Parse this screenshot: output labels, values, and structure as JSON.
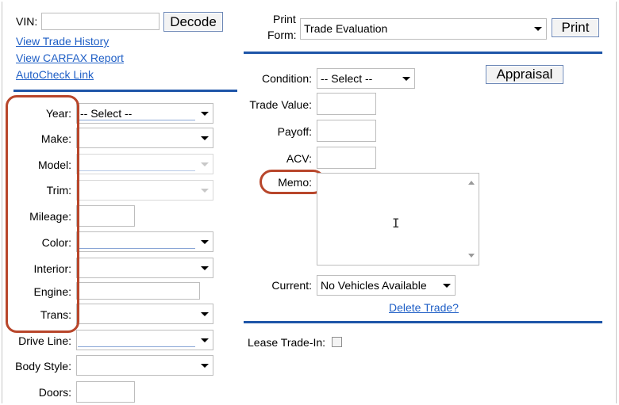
{
  "left": {
    "vin_label": "VIN:",
    "vin_value": "",
    "decode_label": "Decode",
    "links": [
      "View Trade History",
      "View CARFAX Report",
      "AutoCheck Link"
    ],
    "fields": {
      "year": {
        "label": "Year:",
        "value": "-- Select --"
      },
      "make": {
        "label": "Make:",
        "value": ""
      },
      "model": {
        "label": "Model:",
        "value": ""
      },
      "trim": {
        "label": "Trim:",
        "value": ""
      },
      "mileage": {
        "label": "Mileage:",
        "value": ""
      },
      "color": {
        "label": "Color:",
        "value": ""
      },
      "interior": {
        "label": "Interior:",
        "value": ""
      },
      "engine": {
        "label": "Engine:",
        "value": ""
      },
      "trans": {
        "label": "Trans:",
        "value": ""
      },
      "drive_line": {
        "label": "Drive Line:",
        "value": ""
      },
      "body_style": {
        "label": "Body Style:",
        "value": ""
      },
      "doors": {
        "label": "Doors:",
        "value": ""
      }
    }
  },
  "right": {
    "print_form_label_1": "Print",
    "print_form_label_2": "Form:",
    "print_form_value": "Trade Evaluation",
    "print_label": "Print",
    "appraisal_label": "Appraisal",
    "condition": {
      "label": "Condition:",
      "value": "-- Select --"
    },
    "trade_value_label": "Trade Value:",
    "payoff_label": "Payoff:",
    "acv_label": "ACV:",
    "memo_label": "Memo:",
    "memo_value": "",
    "current": {
      "label": "Current:",
      "value": "No Vehicles Available"
    },
    "delete_trade": "Delete Trade?",
    "lease_trade_in_label": "Lease Trade-In:",
    "lease_trade_in_checked": false
  },
  "colors": {
    "rule": "#1e55a8",
    "link": "#1f5fc6",
    "callout": "#b8462b"
  }
}
